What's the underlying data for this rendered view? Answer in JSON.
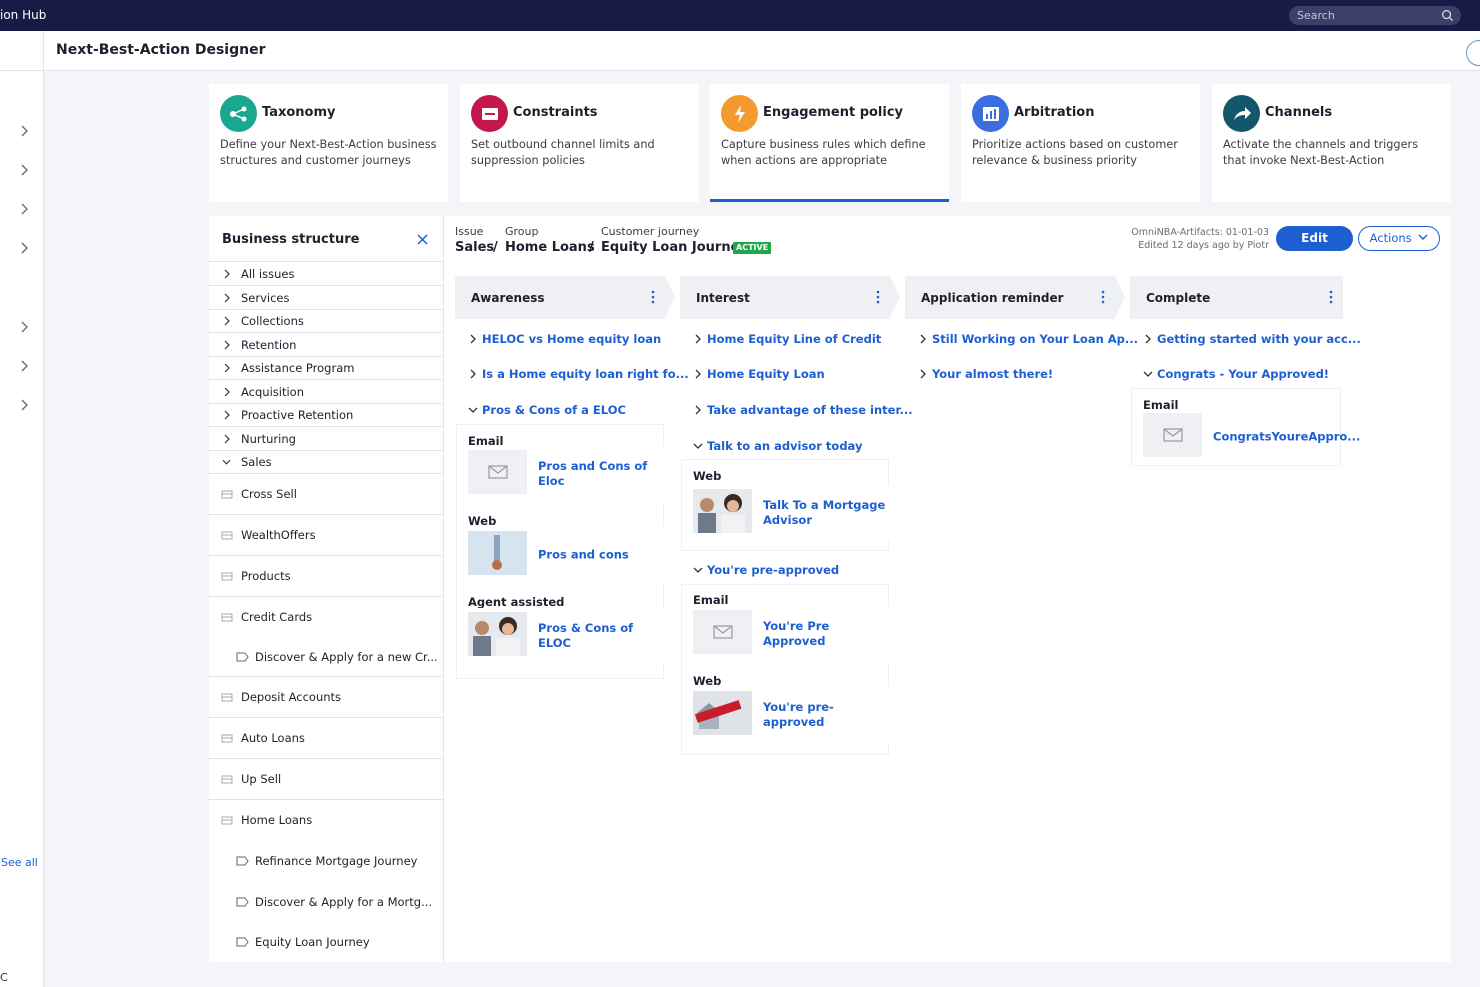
{
  "app": {
    "name": "ion Hub",
    "search_placeholder": "Search"
  },
  "header": {
    "title": "Next-Best-Action Designer"
  },
  "leftnav": {
    "see_all": "See all",
    "footer_char": "C"
  },
  "cards": [
    {
      "title": "Taxonomy",
      "desc": "Define your Next-Best-Action business structures and customer journeys",
      "color": "#19a78f",
      "icon": "taxonomy-icon"
    },
    {
      "title": "Constraints",
      "desc": "Set outbound channel limits and suppression policies",
      "color": "#c4184c",
      "icon": "constraints-icon"
    },
    {
      "title": "Engagement policy",
      "desc": "Capture business rules which define when actions are appropriate",
      "color": "#f59a2d",
      "icon": "lightning-icon",
      "active": true
    },
    {
      "title": "Arbitration",
      "desc": "Prioritize actions based on customer relevance & business priority",
      "color": "#3b6fe0",
      "icon": "arbitration-icon"
    },
    {
      "title": "Channels",
      "desc": "Activate the channels and triggers that invoke Next-Best-Action",
      "color": "#14566b",
      "icon": "share-arrow-icon"
    }
  ],
  "business_structure": {
    "title": "Business structure",
    "issues": [
      "All issues",
      "Services",
      "Collections",
      "Retention",
      "Assistance Program",
      "Acquisition",
      "Proactive Retention",
      "Nurturing",
      "Sales"
    ],
    "groups": [
      {
        "label": "Cross Sell"
      },
      {
        "label": "WealthOffers"
      },
      {
        "label": "Products"
      },
      {
        "label": "Credit Cards",
        "leaves": [
          "Discover & Apply for a new Cr..."
        ]
      },
      {
        "label": "Deposit Accounts"
      },
      {
        "label": "Auto Loans"
      },
      {
        "label": "Up Sell"
      },
      {
        "label": "Home Loans",
        "leaves": [
          "Refinance Mortgage Journey",
          "Discover & Apply for a Mortg...",
          "Equity Loan Journey"
        ]
      }
    ]
  },
  "breadcrumb": {
    "labels": [
      "Issue",
      "Group",
      "Customer journey"
    ],
    "values": [
      "Sales",
      "Home Loans",
      "Equity Loan Journey"
    ],
    "sep": "/",
    "badge": "ACTIVE"
  },
  "meta": {
    "artifact": "OmniNBA-Artifacts: 01-01-03",
    "edited": "Edited 12 days ago by Piotr"
  },
  "buttons": {
    "edit": "Edit",
    "actions": "Actions"
  },
  "stages": [
    {
      "name": "Awareness",
      "steps": [
        "HELOC vs Home equity loan",
        "Is a Home equity loan right fo...",
        "Pros & Cons of a ELOC"
      ],
      "assets": [
        {
          "channel": "Email",
          "name": "Pros and Cons of Eloc",
          "kind": "email"
        },
        {
          "channel": "Web",
          "name": "Pros and cons",
          "kind": "web"
        },
        {
          "channel": "Agent assisted",
          "name": "Pros & Cons of ELOC",
          "kind": "agent"
        }
      ]
    },
    {
      "name": "Interest",
      "steps": [
        "Home Equity Line of Credit",
        "Home Equity Loan",
        "Take advantage of these inter...",
        "Talk to an advisor today",
        "You're pre-approved"
      ],
      "assets": [
        {
          "channel": "Web",
          "name": "Talk To a Mortgage Advisor",
          "kind": "agent"
        },
        {
          "channel": "Email",
          "name": "You're Pre Approved",
          "kind": "email"
        },
        {
          "channel": "Web",
          "name": "You're pre-approved",
          "kind": "preapproved"
        }
      ]
    },
    {
      "name": "Application reminder",
      "steps": [
        "Still Working on Your Loan Ap...",
        "Your almost there!"
      ]
    },
    {
      "name": "Complete",
      "steps": [
        "Getting started with your acc...",
        "Congrats - Your Approved!"
      ],
      "assets": [
        {
          "channel": "Email",
          "name": "CongratsYoureAppro...",
          "kind": "email"
        }
      ]
    }
  ]
}
